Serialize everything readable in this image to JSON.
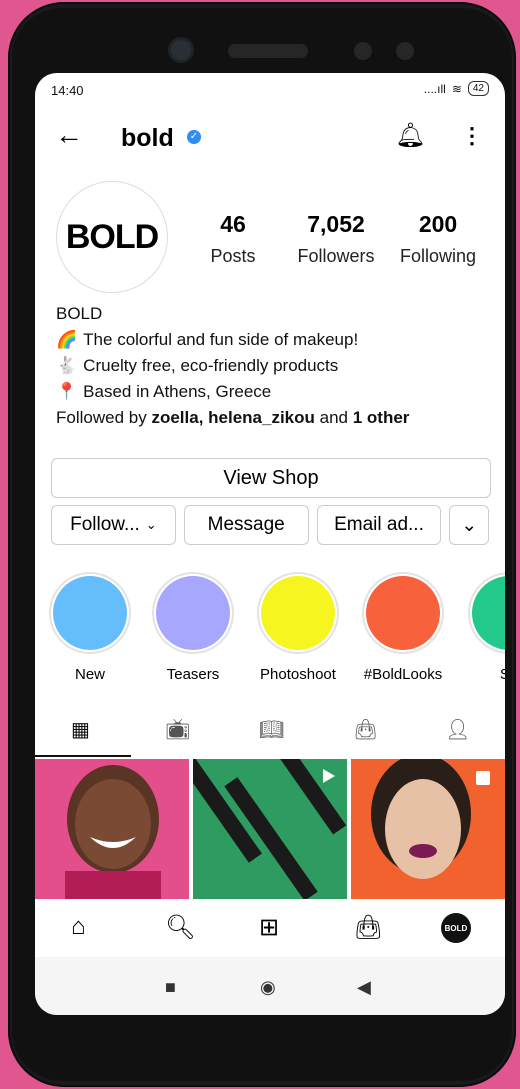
{
  "status": {
    "time": "14:40",
    "signal": "....ıll",
    "wifi": "≋",
    "battery": "42"
  },
  "header": {
    "handle": "bold",
    "verified": "✓"
  },
  "profile": {
    "avatar_text": "BOLD",
    "stats": [
      {
        "value": "46",
        "label": "Posts"
      },
      {
        "value": "7,052",
        "label": "Followers"
      },
      {
        "value": "200",
        "label": "Following"
      }
    ],
    "bio_title": "BOLD",
    "bio_lines": [
      {
        "emoji": "🌈",
        "text": "The colorful and fun side of makeup!"
      },
      {
        "emoji": "🐇",
        "text": "Cruelty free, eco-friendly products"
      },
      {
        "emoji": "📍",
        "text": "Based in Athens, Greece"
      }
    ],
    "followed_by": {
      "prefix": "Followed by",
      "names": "zoella, helena_zikou",
      "middle": "and",
      "others": "1 other"
    }
  },
  "actions": {
    "view_shop": "View Shop",
    "follow": "Follow...",
    "message": "Message",
    "email": "Email ad..."
  },
  "highlights": [
    {
      "label": "New",
      "color": "#66bdfb"
    },
    {
      "label": "Teasers",
      "color": "#a7a7ff"
    },
    {
      "label": "Photoshoot",
      "color": "#f7f520"
    },
    {
      "label": "#BoldLooks",
      "color": "#f7613b"
    },
    {
      "label": "Sa",
      "color": "#22c98b"
    }
  ],
  "colors": {
    "accent": "#2f8ef0",
    "phone_bg": "#e0578f"
  },
  "tiles": [
    {
      "bg": "#e34f8a"
    },
    {
      "bg": "#2e9c61"
    },
    {
      "bg": "#f2622f"
    }
  ]
}
